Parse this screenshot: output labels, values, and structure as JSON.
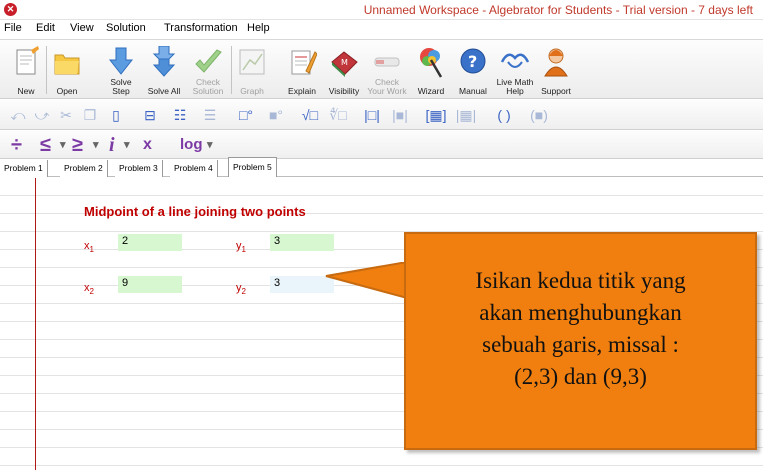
{
  "window": {
    "title": "Unnamed Workspace - Algebrator for Students - Trial version - 7 days left",
    "icon_color": "#c8202a"
  },
  "menu": [
    "File",
    "Edit",
    "View",
    "Solution",
    "Transformation",
    "Help"
  ],
  "toolbar": {
    "new": "New",
    "open": "Open",
    "solve_step": "Solve\nStep",
    "solve_all": "Solve All",
    "check_solution": "Check\nSolution",
    "graph": "Graph",
    "explain": "Explain",
    "visibility": "Visibility",
    "check_your_work": "Check\nYour Work",
    "wizard": "Wizard",
    "manual": "Manual",
    "live_math_help": "Live Math\nHelp",
    "support": "Support"
  },
  "operators": {
    "divide": "÷",
    "less_equal": "≤",
    "greater_equal": "≥",
    "imaginary": "i",
    "subscript": "x",
    "log": "log"
  },
  "tabs": [
    "Problem 1",
    "Problem 2",
    "Problem 3",
    "Problem 4",
    "Problem 5"
  ],
  "active_tab": "Problem 5",
  "worksheet": {
    "heading": "Midpoint of a line joining two points",
    "x1": {
      "var": "x",
      "sub": "1",
      "value": "2"
    },
    "y1": {
      "var": "y",
      "sub": "1",
      "value": "3"
    },
    "x2": {
      "var": "x",
      "sub": "2",
      "value": "9"
    },
    "y2": {
      "var": "y",
      "sub": "2",
      "value": "3"
    }
  },
  "callout": {
    "text": "Isikan kedua titik yang\nakan menghubungkan\nsebuah garis, missal :\n(2,3) dan (9,3)",
    "color": "#f07f0f"
  },
  "colors": {
    "accent_red": "#c00000",
    "field_green": "#d6f7d0",
    "operator_purple": "#7c3aa5"
  }
}
